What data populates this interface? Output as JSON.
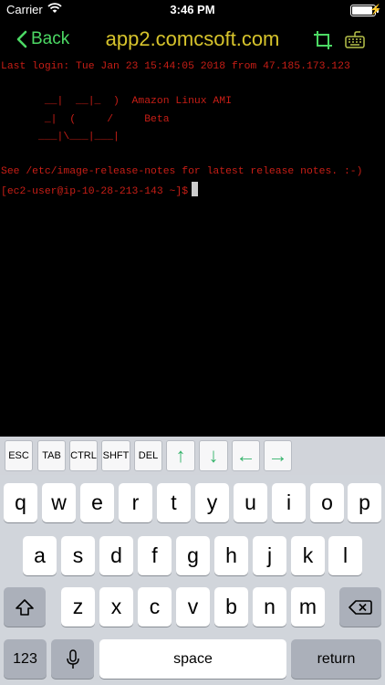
{
  "status_bar": {
    "carrier": "Carrier",
    "time": "3:46 PM"
  },
  "nav": {
    "back_label": "Back",
    "title": "app2.comcsoft.com",
    "icons": [
      "crop-icon",
      "keyboard-icon"
    ]
  },
  "terminal": {
    "color": "#c81e16",
    "last_login": "Last login: Tue Jan 23 15:44:05 2018 from 47.185.173.123",
    "art": [
      "       __|  __|_  )  Amazon Linux AMI",
      "       _|  (     /     Beta",
      "      ___|\\___|___|"
    ],
    "release_notes": "See /etc/image-release-notes for latest release notes. :-)",
    "prompt": "[ec2-user@ip-10-28-213-143 ~]$"
  },
  "accessory_bar": {
    "keys": [
      "ESC",
      "TAB",
      "CTRL",
      "SHFT",
      "DEL"
    ],
    "arrows": [
      "↑",
      "↓",
      "←",
      "→"
    ],
    "arrow_color": "#34b36a"
  },
  "keyboard": {
    "row1": [
      "q",
      "w",
      "e",
      "r",
      "t",
      "y",
      "u",
      "i",
      "o",
      "p"
    ],
    "row2": [
      "a",
      "s",
      "d",
      "f",
      "g",
      "h",
      "j",
      "k",
      "l"
    ],
    "row3": [
      "z",
      "x",
      "c",
      "v",
      "b",
      "n",
      "m"
    ],
    "numbers_label": "123",
    "space_label": "space",
    "return_label": "return"
  }
}
